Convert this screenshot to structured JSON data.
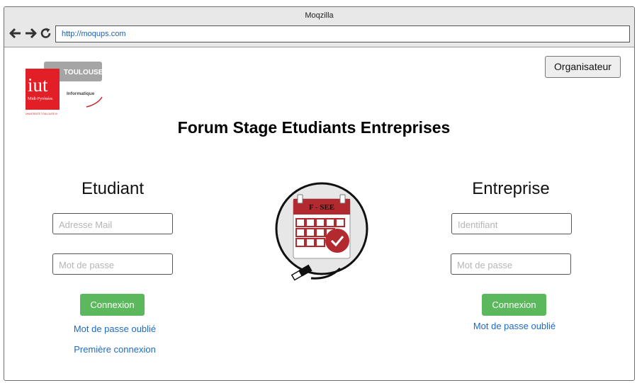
{
  "browser": {
    "title": "Moqzilla",
    "url": "http://moqups.com"
  },
  "logo": {
    "brand": "iut",
    "region": "Midi-Pyrénées",
    "city": "TOULOUSE",
    "department": "Informatique",
    "footer": "UNIVERSITÉ TOULOUSE III"
  },
  "header": {
    "organizer_label": "Organisateur",
    "page_title": "Forum Stage Etudiants Entreprises"
  },
  "student": {
    "title": "Etudiant",
    "email_placeholder": "Adresse Mail",
    "password_placeholder": "Mot de passe",
    "login_label": "Connexion",
    "forgot_label": "Mot de passe oublié",
    "first_login_label": "Première connexion"
  },
  "company": {
    "title": "Entreprise",
    "id_placeholder": "Identifiant",
    "password_placeholder": "Mot de passe",
    "login_label": "Connexion",
    "forgot_label": "Mot de passe oublié"
  },
  "illustration": {
    "calendar_label": "F - SEE"
  },
  "colors": {
    "accent_red": "#b22a2f",
    "button_green": "#5cb85c",
    "link_blue": "#1e6bc4"
  }
}
